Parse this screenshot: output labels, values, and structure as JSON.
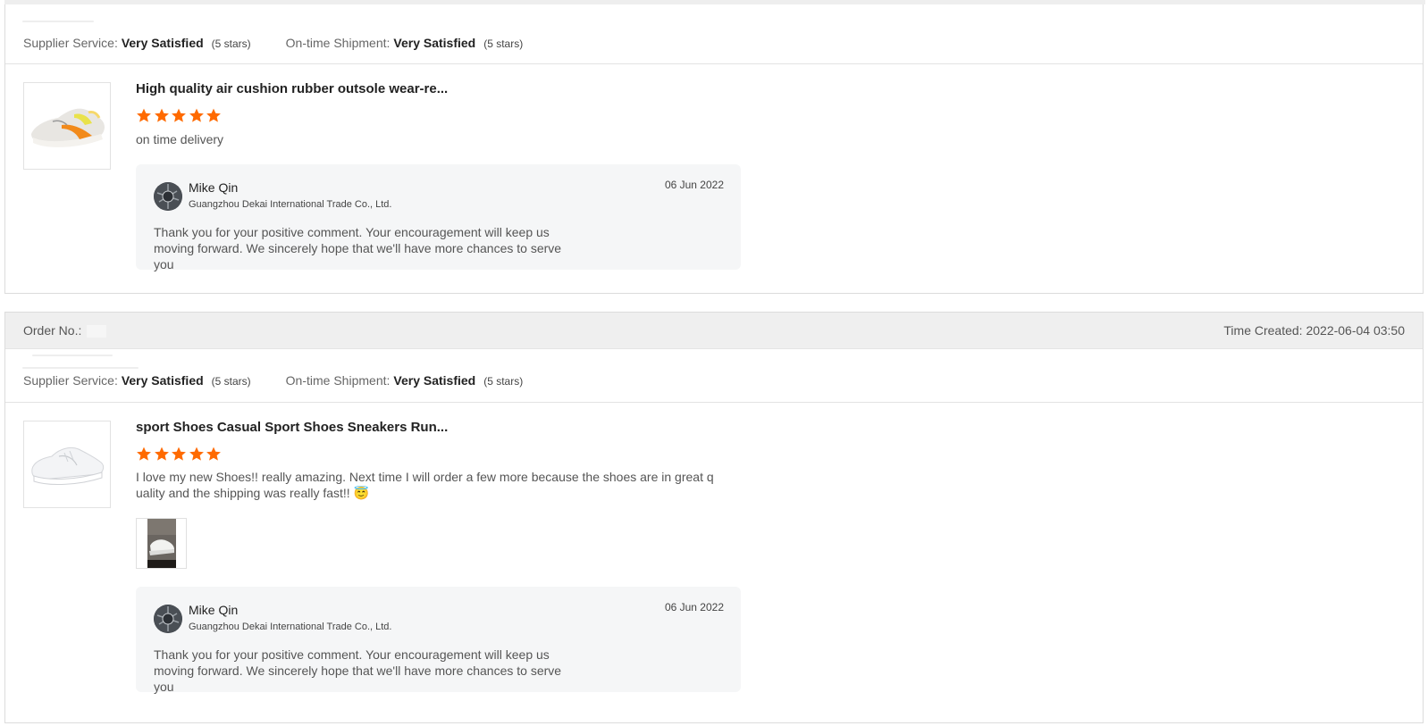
{
  "colors": {
    "star": "#ff6a00",
    "header_bg": "#efefef",
    "reply_bg": "#f5f6f7"
  },
  "reviews": [
    {
      "ratings": {
        "supplier_label": "Supplier Service:",
        "supplier_value": "Very Satisfied",
        "supplier_stars": "(5 stars)",
        "shipment_label": "On-time Shipment:",
        "shipment_value": "Very Satisfied",
        "shipment_stars": "(5 stars)"
      },
      "product": {
        "title": "High quality air cushion rubber outsole wear-re...",
        "rating": 5,
        "review": "on time delivery",
        "image_icon": "running-shoe-image"
      },
      "reply": {
        "name": "Mike Qin",
        "company": "Guangzhou Dekai International Trade Co., Ltd.",
        "date": "06 Jun 2022",
        "text": "Thank you for your positive comment. Your encouragement will keep us moving forward. We sincerely hope that we'll have more chances to serve you"
      }
    },
    {
      "order": {
        "order_label": "Order No.:",
        "time_created": "Time Created: 2022-06-04 03:50"
      },
      "ratings": {
        "supplier_label": "Supplier Service:",
        "supplier_value": "Very Satisfied",
        "supplier_stars": "(5 stars)",
        "shipment_label": "On-time Shipment:",
        "shipment_value": "Very Satisfied",
        "shipment_stars": "(5 stars)"
      },
      "product": {
        "title": "sport Shoes Casual Sport Shoes Sneakers Run...",
        "rating": 5,
        "review": "I love my new Shoes!! really amazing. Next time I will order a few more because the shoes are in great quality and the shipping was really fast!! 😇",
        "image_icon": "white-sneaker-image",
        "photo_icon": "customer-photo-image"
      },
      "reply": {
        "name": "Mike Qin",
        "company": "Guangzhou Dekai International Trade Co., Ltd.",
        "date": "06 Jun 2022",
        "text": "Thank you for your positive comment. Your encouragement will keep us moving forward. We sincerely hope that we'll have more chances to serve you"
      }
    }
  ]
}
